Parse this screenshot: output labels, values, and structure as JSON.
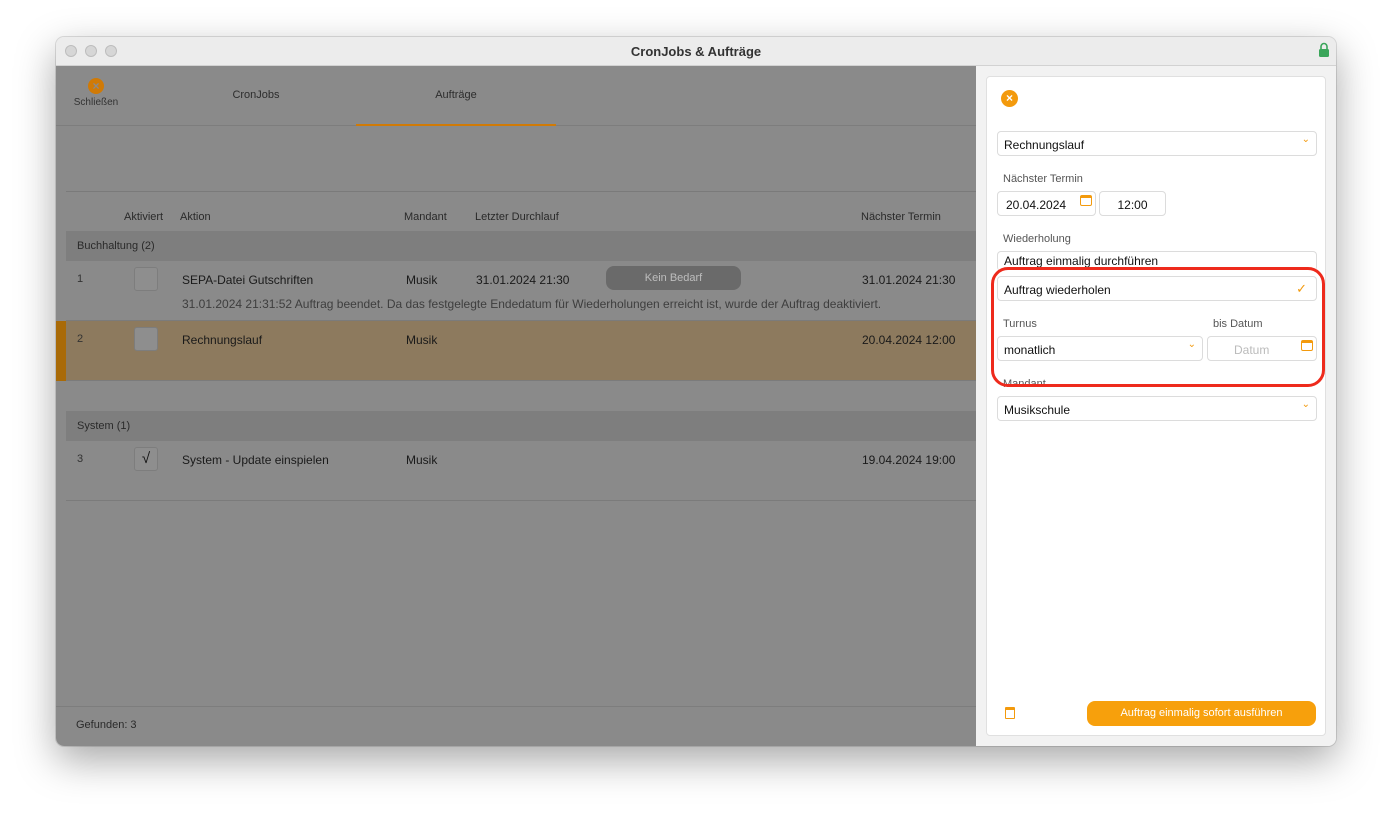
{
  "window": {
    "title": "CronJobs & Aufträge"
  },
  "toolbar": {
    "close_label": "Schließen",
    "tabs": [
      {
        "label": "CronJobs"
      },
      {
        "label": "Aufträge"
      }
    ],
    "active_tab": "Aufträge"
  },
  "table": {
    "columns": [
      "Aktiviert",
      "Aktion",
      "Mandant",
      "Letzter Durchlauf",
      "Nächster Termin"
    ],
    "groups": [
      {
        "label": "Buchhaltung (2)",
        "rows": [
          {
            "num": "1",
            "checked": "",
            "aktion": "SEPA-Datei Gutschriften",
            "mandant": "Musik",
            "letzter": "31.01.2024 21:30",
            "badge": "Kein Bedarf",
            "naechster": "31.01.2024 21:30",
            "note": "31.01.2024 21:31:52 Auftrag beendet. Da das festgelegte Endedatum für Wiederholungen erreicht ist, wurde der Auftrag deaktiviert."
          },
          {
            "num": "2",
            "checked": "",
            "aktion": "Rechnungslauf",
            "mandant": "Musik",
            "letzter": "",
            "naechster": "20.04.2024 12:00",
            "selected": true
          }
        ]
      },
      {
        "label": "System (1)",
        "rows": [
          {
            "num": "3",
            "checked": "√",
            "aktion": "System - Update einspielen",
            "mandant": "Musik",
            "letzter": "",
            "naechster": "19.04.2024 19:00"
          }
        ]
      }
    ],
    "footer": "Gefunden: 3"
  },
  "panel": {
    "job_type": "Rechnungslauf",
    "next_date_label": "Nächster Termin",
    "next_date": "20.04.2024",
    "next_time": "12:00",
    "repeat_label": "Wiederholung",
    "repeat_option_hidden": "Auftrag einmalig durchführen",
    "repeat_option_selected": "Auftrag wiederholen",
    "turnus_label": "Turnus",
    "turnus_value": "monatlich",
    "until_label": "bis Datum",
    "until_placeholder": "Datum",
    "mandant_label": "Mandant",
    "mandant_value": "Musikschule",
    "run_button": "Auftrag einmalig sofort ausführen"
  },
  "colors": {
    "accent": "#f39a0d",
    "highlight": "#ee2a1c",
    "selection": "#a96a07"
  }
}
